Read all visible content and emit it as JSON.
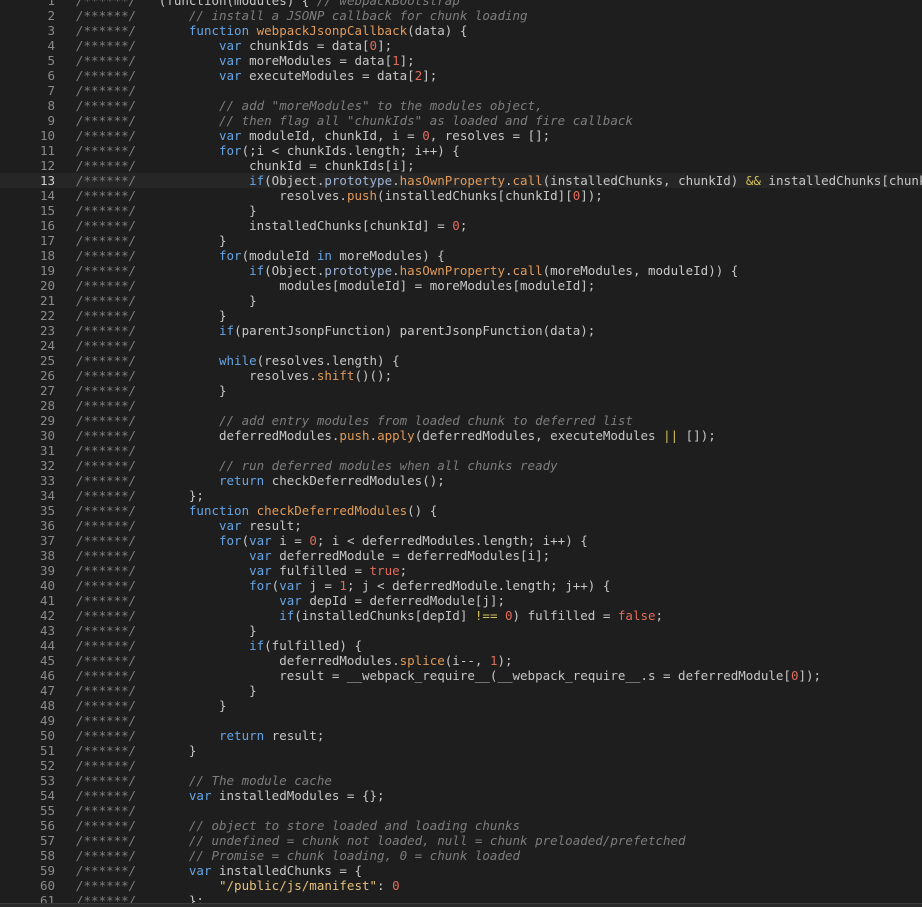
{
  "editor": {
    "highlighted_line": 13,
    "colors": {
      "background": "#1e1e1e",
      "comment": "#7d7d7d",
      "keyword": "#66a4e3",
      "function": "#e09a5a",
      "number": "#e06c5c",
      "string": "#e5c078",
      "plain": "#c7c7c7",
      "line_number": "#8a8a8a"
    },
    "lines": [
      {
        "n": "1",
        "t": [
          [
            "cm",
            "/******/ "
          ],
          [
            "p",
            "(function(modules) { "
          ],
          [
            "cm",
            "// webpackBootstrap"
          ]
        ]
      },
      {
        "n": "2",
        "t": [
          [
            "cm",
            "/******/ \t"
          ],
          [
            "cm",
            "// install a JSONP callback for chunk loading"
          ]
        ]
      },
      {
        "n": "3",
        "t": [
          [
            "cm",
            "/******/ \t"
          ],
          [
            "kw",
            "function "
          ],
          [
            "fn",
            "webpackJsonpCallback"
          ],
          [
            "p",
            "(data) {"
          ]
        ]
      },
      {
        "n": "4",
        "t": [
          [
            "cm",
            "/******/ \t\t"
          ],
          [
            "kw",
            "var "
          ],
          [
            "p",
            "chunkIds = data["
          ],
          [
            "num",
            "0"
          ],
          [
            "p",
            "];"
          ]
        ]
      },
      {
        "n": "5",
        "t": [
          [
            "cm",
            "/******/ \t\t"
          ],
          [
            "kw",
            "var "
          ],
          [
            "p",
            "moreModules = data["
          ],
          [
            "num",
            "1"
          ],
          [
            "p",
            "];"
          ]
        ]
      },
      {
        "n": "6",
        "t": [
          [
            "cm",
            "/******/ \t\t"
          ],
          [
            "kw",
            "var "
          ],
          [
            "p",
            "executeModules = data["
          ],
          [
            "num",
            "2"
          ],
          [
            "p",
            "];"
          ]
        ]
      },
      {
        "n": "7",
        "t": [
          [
            "cm",
            "/******/"
          ]
        ]
      },
      {
        "n": "8",
        "t": [
          [
            "cm",
            "/******/ \t\t"
          ],
          [
            "cm",
            "// add \"moreModules\" to the modules object,"
          ]
        ]
      },
      {
        "n": "9",
        "t": [
          [
            "cm",
            "/******/ \t\t"
          ],
          [
            "cm",
            "// then flag all \"chunkIds\" as loaded and fire callback"
          ]
        ]
      },
      {
        "n": "10",
        "t": [
          [
            "cm",
            "/******/ \t\t"
          ],
          [
            "kw",
            "var "
          ],
          [
            "p",
            "moduleId, chunkId, i = "
          ],
          [
            "num",
            "0"
          ],
          [
            "p",
            ", resolves = [];"
          ]
        ]
      },
      {
        "n": "11",
        "t": [
          [
            "cm",
            "/******/ \t\t"
          ],
          [
            "kw",
            "for"
          ],
          [
            "p",
            "(;i < chunkIds.length; i++) {"
          ]
        ]
      },
      {
        "n": "12",
        "t": [
          [
            "cm",
            "/******/ \t\t\t"
          ],
          [
            "p",
            "chunkId = chunkIds[i];"
          ]
        ]
      },
      {
        "n": "13",
        "t": [
          [
            "cm",
            "/******/ \t\t\t"
          ],
          [
            "kw",
            "if"
          ],
          [
            "p",
            "(Object."
          ],
          [
            "prop",
            "prototype"
          ],
          [
            "p",
            "."
          ],
          [
            "fn",
            "hasOwnProperty"
          ],
          [
            "p",
            "."
          ],
          [
            "fn",
            "call"
          ],
          [
            "p",
            "(installedChunks, chunkId) "
          ],
          [
            "op",
            "&&"
          ],
          [
            "p",
            " installedChunks[chunkId]) {"
          ],
          [
            "cur",
            ""
          ]
        ]
      },
      {
        "n": "14",
        "t": [
          [
            "cm",
            "/******/ \t\t\t\t"
          ],
          [
            "p",
            "resolves."
          ],
          [
            "fn",
            "push"
          ],
          [
            "p",
            "(installedChunks[chunkId]["
          ],
          [
            "num",
            "0"
          ],
          [
            "p",
            "]);"
          ]
        ]
      },
      {
        "n": "15",
        "t": [
          [
            "cm",
            "/******/ \t\t\t"
          ],
          [
            "p",
            "}"
          ]
        ]
      },
      {
        "n": "16",
        "t": [
          [
            "cm",
            "/******/ \t\t\t"
          ],
          [
            "p",
            "installedChunks[chunkId] = "
          ],
          [
            "num",
            "0"
          ],
          [
            "p",
            ";"
          ]
        ]
      },
      {
        "n": "17",
        "t": [
          [
            "cm",
            "/******/ \t\t"
          ],
          [
            "p",
            "}"
          ]
        ]
      },
      {
        "n": "18",
        "t": [
          [
            "cm",
            "/******/ \t\t"
          ],
          [
            "kw",
            "for"
          ],
          [
            "p",
            "(moduleId "
          ],
          [
            "kw",
            "in"
          ],
          [
            "p",
            " moreModules) {"
          ]
        ]
      },
      {
        "n": "19",
        "t": [
          [
            "cm",
            "/******/ \t\t\t"
          ],
          [
            "kw",
            "if"
          ],
          [
            "p",
            "(Object."
          ],
          [
            "prop",
            "prototype"
          ],
          [
            "p",
            "."
          ],
          [
            "fn",
            "hasOwnProperty"
          ],
          [
            "p",
            "."
          ],
          [
            "fn",
            "call"
          ],
          [
            "p",
            "(moreModules, moduleId)) {"
          ]
        ]
      },
      {
        "n": "20",
        "t": [
          [
            "cm",
            "/******/ \t\t\t\t"
          ],
          [
            "p",
            "modules[moduleId] = moreModules[moduleId];"
          ]
        ]
      },
      {
        "n": "21",
        "t": [
          [
            "cm",
            "/******/ \t\t\t"
          ],
          [
            "p",
            "}"
          ]
        ]
      },
      {
        "n": "22",
        "t": [
          [
            "cm",
            "/******/ \t\t"
          ],
          [
            "p",
            "}"
          ]
        ]
      },
      {
        "n": "23",
        "t": [
          [
            "cm",
            "/******/ \t\t"
          ],
          [
            "kw",
            "if"
          ],
          [
            "p",
            "(parentJsonpFunction) parentJsonpFunction(data);"
          ]
        ]
      },
      {
        "n": "24",
        "t": [
          [
            "cm",
            "/******/"
          ]
        ]
      },
      {
        "n": "25",
        "t": [
          [
            "cm",
            "/******/ \t\t"
          ],
          [
            "kw",
            "while"
          ],
          [
            "p",
            "(resolves.length) {"
          ]
        ]
      },
      {
        "n": "26",
        "t": [
          [
            "cm",
            "/******/ \t\t\t"
          ],
          [
            "p",
            "resolves."
          ],
          [
            "fn",
            "shift"
          ],
          [
            "p",
            "()();"
          ]
        ]
      },
      {
        "n": "27",
        "t": [
          [
            "cm",
            "/******/ \t\t"
          ],
          [
            "p",
            "}"
          ]
        ]
      },
      {
        "n": "28",
        "t": [
          [
            "cm",
            "/******/"
          ]
        ]
      },
      {
        "n": "29",
        "t": [
          [
            "cm",
            "/******/ \t\t"
          ],
          [
            "cm",
            "// add entry modules from loaded chunk to deferred list"
          ]
        ]
      },
      {
        "n": "30",
        "t": [
          [
            "cm",
            "/******/ \t\t"
          ],
          [
            "p",
            "deferredModules."
          ],
          [
            "fn",
            "push"
          ],
          [
            "p",
            "."
          ],
          [
            "fn",
            "apply"
          ],
          [
            "p",
            "(deferredModules, executeModules "
          ],
          [
            "op",
            "||"
          ],
          [
            "p",
            " []);"
          ]
        ]
      },
      {
        "n": "31",
        "t": [
          [
            "cm",
            "/******/"
          ]
        ]
      },
      {
        "n": "32",
        "t": [
          [
            "cm",
            "/******/ \t\t"
          ],
          [
            "cm",
            "// run deferred modules when all chunks ready"
          ]
        ]
      },
      {
        "n": "33",
        "t": [
          [
            "cm",
            "/******/ \t\t"
          ],
          [
            "kw",
            "return "
          ],
          [
            "p",
            "checkDeferredModules();"
          ]
        ]
      },
      {
        "n": "34",
        "t": [
          [
            "cm",
            "/******/ \t"
          ],
          [
            "p",
            "};"
          ]
        ]
      },
      {
        "n": "35",
        "t": [
          [
            "cm",
            "/******/ \t"
          ],
          [
            "kw",
            "function "
          ],
          [
            "fn",
            "checkDeferredModules"
          ],
          [
            "p",
            "() {"
          ]
        ]
      },
      {
        "n": "36",
        "t": [
          [
            "cm",
            "/******/ \t\t"
          ],
          [
            "kw",
            "var "
          ],
          [
            "p",
            "result;"
          ]
        ]
      },
      {
        "n": "37",
        "t": [
          [
            "cm",
            "/******/ \t\t"
          ],
          [
            "kw",
            "for"
          ],
          [
            "p",
            "("
          ],
          [
            "kw",
            "var "
          ],
          [
            "p",
            "i = "
          ],
          [
            "num",
            "0"
          ],
          [
            "p",
            "; i < deferredModules.length; i++) {"
          ]
        ]
      },
      {
        "n": "38",
        "t": [
          [
            "cm",
            "/******/ \t\t\t"
          ],
          [
            "kw",
            "var "
          ],
          [
            "p",
            "deferredModule = deferredModules[i];"
          ]
        ]
      },
      {
        "n": "39",
        "t": [
          [
            "cm",
            "/******/ \t\t\t"
          ],
          [
            "kw",
            "var "
          ],
          [
            "p",
            "fulfilled = "
          ],
          [
            "num",
            "true"
          ],
          [
            "p",
            ";"
          ]
        ]
      },
      {
        "n": "40",
        "t": [
          [
            "cm",
            "/******/ \t\t\t"
          ],
          [
            "kw",
            "for"
          ],
          [
            "p",
            "("
          ],
          [
            "kw",
            "var "
          ],
          [
            "p",
            "j = "
          ],
          [
            "num",
            "1"
          ],
          [
            "p",
            "; j < deferredModule.length; j++) {"
          ]
        ]
      },
      {
        "n": "41",
        "t": [
          [
            "cm",
            "/******/ \t\t\t\t"
          ],
          [
            "kw",
            "var "
          ],
          [
            "p",
            "depId = deferredModule[j];"
          ]
        ]
      },
      {
        "n": "42",
        "t": [
          [
            "cm",
            "/******/ \t\t\t\t"
          ],
          [
            "kw",
            "if"
          ],
          [
            "p",
            "(installedChunks[depId] "
          ],
          [
            "op",
            "!=="
          ],
          [
            "p",
            " "
          ],
          [
            "num",
            "0"
          ],
          [
            "p",
            ") fulfilled = "
          ],
          [
            "num",
            "false"
          ],
          [
            "p",
            ";"
          ]
        ]
      },
      {
        "n": "43",
        "t": [
          [
            "cm",
            "/******/ \t\t\t"
          ],
          [
            "p",
            "}"
          ]
        ]
      },
      {
        "n": "44",
        "t": [
          [
            "cm",
            "/******/ \t\t\t"
          ],
          [
            "kw",
            "if"
          ],
          [
            "p",
            "(fulfilled) {"
          ]
        ]
      },
      {
        "n": "45",
        "t": [
          [
            "cm",
            "/******/ \t\t\t\t"
          ],
          [
            "p",
            "deferredModules."
          ],
          [
            "fn",
            "splice"
          ],
          [
            "p",
            "(i--, "
          ],
          [
            "num",
            "1"
          ],
          [
            "p",
            ");"
          ]
        ]
      },
      {
        "n": "46",
        "t": [
          [
            "cm",
            "/******/ \t\t\t\t"
          ],
          [
            "p",
            "result = __webpack_require__(__webpack_require__.s = deferredModule["
          ],
          [
            "num",
            "0"
          ],
          [
            "p",
            "]);"
          ]
        ]
      },
      {
        "n": "47",
        "t": [
          [
            "cm",
            "/******/ \t\t\t"
          ],
          [
            "p",
            "}"
          ]
        ]
      },
      {
        "n": "48",
        "t": [
          [
            "cm",
            "/******/ \t\t"
          ],
          [
            "p",
            "}"
          ]
        ]
      },
      {
        "n": "49",
        "t": [
          [
            "cm",
            "/******/"
          ]
        ]
      },
      {
        "n": "50",
        "t": [
          [
            "cm",
            "/******/ \t\t"
          ],
          [
            "kw",
            "return "
          ],
          [
            "p",
            "result;"
          ]
        ]
      },
      {
        "n": "51",
        "t": [
          [
            "cm",
            "/******/ \t"
          ],
          [
            "p",
            "}"
          ]
        ]
      },
      {
        "n": "52",
        "t": [
          [
            "cm",
            "/******/"
          ]
        ]
      },
      {
        "n": "53",
        "t": [
          [
            "cm",
            "/******/ \t"
          ],
          [
            "cm",
            "// The module cache"
          ]
        ]
      },
      {
        "n": "54",
        "t": [
          [
            "cm",
            "/******/ \t"
          ],
          [
            "kw",
            "var "
          ],
          [
            "p",
            "installedModules = {};"
          ]
        ]
      },
      {
        "n": "55",
        "t": [
          [
            "cm",
            "/******/"
          ]
        ]
      },
      {
        "n": "56",
        "t": [
          [
            "cm",
            "/******/ \t"
          ],
          [
            "cm",
            "// object to store loaded and loading chunks"
          ]
        ]
      },
      {
        "n": "57",
        "t": [
          [
            "cm",
            "/******/ \t"
          ],
          [
            "cm",
            "// undefined = chunk not loaded, null = chunk preloaded/prefetched"
          ]
        ]
      },
      {
        "n": "58",
        "t": [
          [
            "cm",
            "/******/ \t"
          ],
          [
            "cm",
            "// Promise = chunk loading, 0 = chunk loaded"
          ]
        ]
      },
      {
        "n": "59",
        "t": [
          [
            "cm",
            "/******/ \t"
          ],
          [
            "kw",
            "var "
          ],
          [
            "p",
            "installedChunks = {"
          ]
        ]
      },
      {
        "n": "60",
        "t": [
          [
            "cm",
            "/******/ \t\t"
          ],
          [
            "str",
            "\"/public/js/manifest\""
          ],
          [
            "p",
            ": "
          ],
          [
            "num",
            "0"
          ]
        ]
      },
      {
        "n": "61",
        "t": [
          [
            "cm",
            "/******/ \t"
          ],
          [
            "p",
            "};"
          ]
        ]
      }
    ]
  }
}
